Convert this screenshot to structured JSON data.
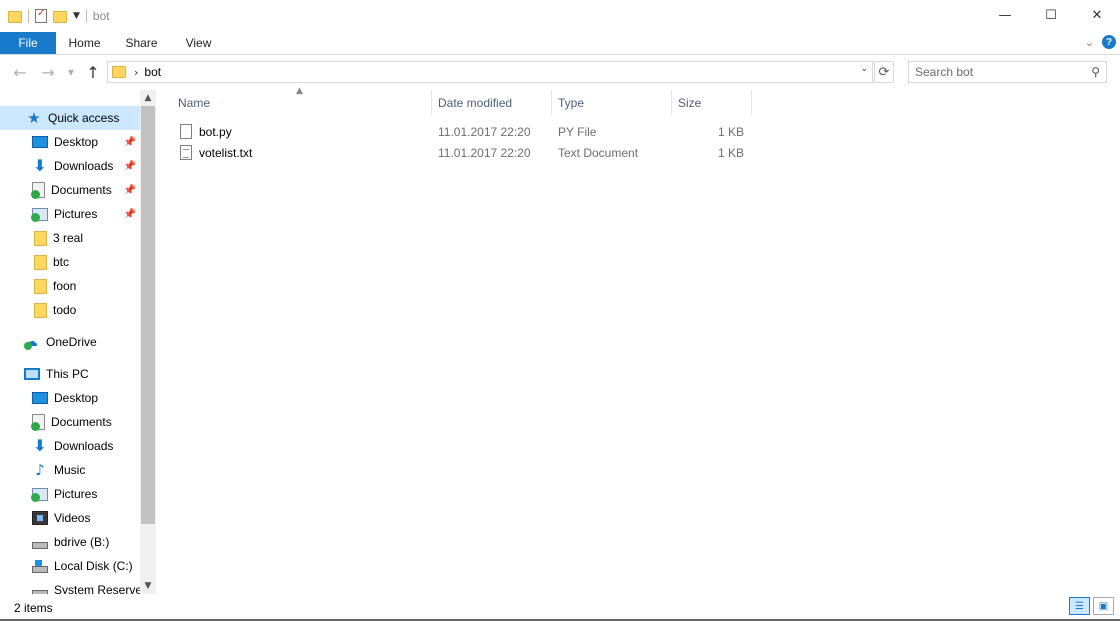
{
  "window": {
    "title": "bot",
    "controls": {
      "minimize": "—",
      "maximize": "☐",
      "close": "✕"
    }
  },
  "ribbon": {
    "tabs": [
      "File",
      "Home",
      "Share",
      "View"
    ],
    "help_label": "?"
  },
  "address": {
    "path": "bot",
    "search_placeholder": "Search bot"
  },
  "nav_pane": {
    "quick_access": "Quick access",
    "quick_items": [
      {
        "label": "Desktop",
        "icon": "desktop-icon",
        "pinned": true
      },
      {
        "label": "Downloads",
        "icon": "downloads-icon",
        "pinned": true
      },
      {
        "label": "Documents",
        "icon": "documents-icon",
        "pinned": true
      },
      {
        "label": "Pictures",
        "icon": "pictures-icon",
        "pinned": true
      },
      {
        "label": "3 real",
        "icon": "folder-icon",
        "pinned": false
      },
      {
        "label": "btc",
        "icon": "folder-icon",
        "pinned": false
      },
      {
        "label": "foon",
        "icon": "folder-icon",
        "pinned": false
      },
      {
        "label": "todo",
        "icon": "folder-icon",
        "pinned": false
      }
    ],
    "onedrive": "OneDrive",
    "this_pc": "This PC",
    "pc_items": [
      {
        "label": "Desktop",
        "icon": "desktop-icon"
      },
      {
        "label": "Documents",
        "icon": "documents-icon"
      },
      {
        "label": "Downloads",
        "icon": "downloads-icon"
      },
      {
        "label": "Music",
        "icon": "music-icon"
      },
      {
        "label": "Pictures",
        "icon": "pictures-icon"
      },
      {
        "label": "Videos",
        "icon": "videos-icon"
      },
      {
        "label": "bdrive (B:)",
        "icon": "drive-icon"
      },
      {
        "label": "Local Disk (C:)",
        "icon": "windows-drive-icon"
      },
      {
        "label": "System Reserved",
        "icon": "drive-icon"
      }
    ]
  },
  "file_list": {
    "columns": [
      "Name",
      "Date modified",
      "Type",
      "Size"
    ],
    "rows": [
      {
        "name": "bot.py",
        "date": "11.01.2017 22:20",
        "type": "PY File",
        "size": "1 KB"
      },
      {
        "name": "votelist.txt",
        "date": "11.01.2017 22:20",
        "type": "Text Document",
        "size": "1 KB"
      }
    ]
  },
  "status": {
    "item_count": "2 items"
  },
  "colors": {
    "accent": "#1979ca",
    "selected_bg": "#cce8ff",
    "folder": "#ffd75e"
  }
}
